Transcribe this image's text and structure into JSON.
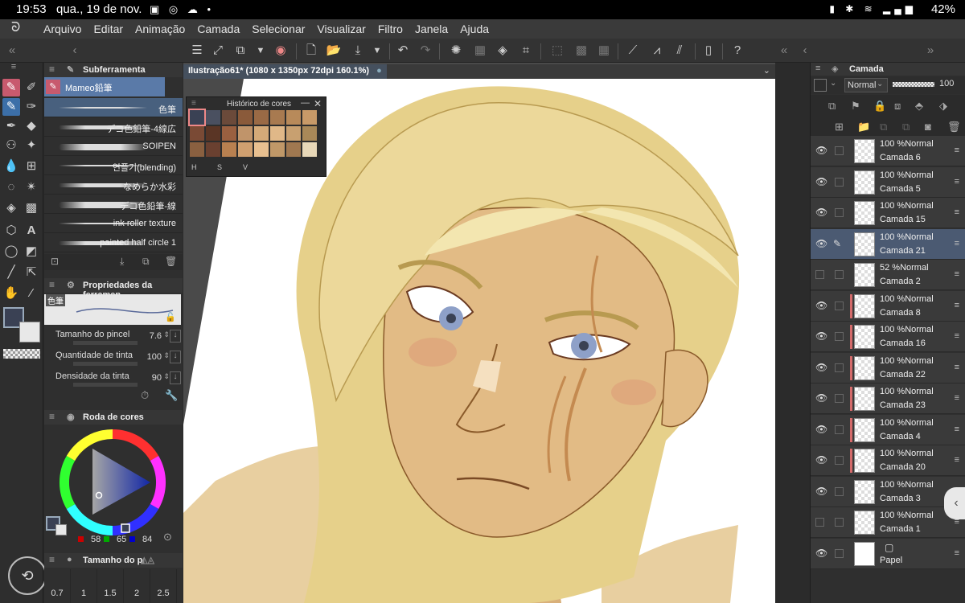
{
  "status": {
    "time": "19:53",
    "date": "qua., 19 de nov.",
    "battery": "42%"
  },
  "menu": [
    "Arquivo",
    "Editar",
    "Animação",
    "Camada",
    "Selecionar",
    "Visualizar",
    "Filtro",
    "Janela",
    "Ajuda"
  ],
  "subtool": {
    "title": "Subferramenta",
    "group": "Mameo鉛筆",
    "brushes": [
      "色筆",
      "デコ色鉛筆-4線広",
      "SOIPEN",
      "연플기(blending)",
      "なめらか水彩",
      "デコ色鉛筆-線",
      "ink roller texture",
      "painted half circle 1"
    ]
  },
  "toolprops": {
    "title": "Propriedades da ferramen",
    "brush_name": "色筆",
    "rows": [
      {
        "label": "Tamanho do pincel",
        "value": "7.6"
      },
      {
        "label": "Quantidade de tinta",
        "value": "100"
      },
      {
        "label": "Densidade da tinta",
        "value": "90"
      }
    ]
  },
  "colorwheel": {
    "title": "Roda de cores",
    "r": "58",
    "g": "65",
    "b": "84",
    "main_color": "#3a4154"
  },
  "brushsize": {
    "title": "Tamanho do p",
    "values": [
      "0.7",
      "1",
      "1.5",
      "2",
      "2.5"
    ]
  },
  "document": {
    "tab": "Ilustração61* (1080 x 1350px 72dpi 160.1%)"
  },
  "colorhistory": {
    "title": "Histórico de cores",
    "modes": [
      "H",
      "S",
      "V"
    ],
    "swatches": [
      "#3a4154",
      "#4a5060",
      "#6b4a3a",
      "#8a5a3a",
      "#9a6a45",
      "#a87a50",
      "#b88a5a",
      "#c89a68",
      "#7a4a35",
      "#5a3525",
      "#9a6040",
      "#c0946a",
      "#d4aa78",
      "#e0b888",
      "#c8a070",
      "#a88858",
      "#8a6040",
      "#6a4030",
      "#b88050",
      "#d0a070",
      "#e8c090",
      "#c09868",
      "#a07850",
      "#e8d8b8"
    ]
  },
  "layerpanel": {
    "title": "Camada",
    "blend": "Normal",
    "opacity": "100",
    "layers": [
      {
        "op": "100 %Normal",
        "name": "Camada 6",
        "eye": true,
        "sel": false,
        "red": false
      },
      {
        "op": "100 %Normal",
        "name": "Camada 5",
        "eye": true,
        "sel": false,
        "red": false
      },
      {
        "op": "100 %Normal",
        "name": "Camada 15",
        "eye": true,
        "sel": false,
        "red": false
      },
      {
        "op": "100 %Normal",
        "name": "Camada 21",
        "eye": true,
        "sel": true,
        "red": false
      },
      {
        "op": "52 %Normal",
        "name": "Camada 2",
        "eye": false,
        "sel": false,
        "red": false
      },
      {
        "op": "100 %Normal",
        "name": "Camada 8",
        "eye": true,
        "sel": false,
        "red": true
      },
      {
        "op": "100 %Normal",
        "name": "Camada 16",
        "eye": true,
        "sel": false,
        "red": true
      },
      {
        "op": "100 %Normal",
        "name": "Camada 22",
        "eye": true,
        "sel": false,
        "red": true
      },
      {
        "op": "100 %Normal",
        "name": "Camada 23",
        "eye": true,
        "sel": false,
        "red": true
      },
      {
        "op": "100 %Normal",
        "name": "Camada 4",
        "eye": true,
        "sel": false,
        "red": true
      },
      {
        "op": "100 %Normal",
        "name": "Camada 20",
        "eye": true,
        "sel": false,
        "red": true
      },
      {
        "op": "100 %Normal",
        "name": "Camada 3",
        "eye": true,
        "sel": false,
        "red": false
      },
      {
        "op": "100 %Normal",
        "name": "Camada 1",
        "eye": false,
        "sel": false,
        "red": false
      },
      {
        "op": "",
        "name": "Papel",
        "eye": true,
        "sel": false,
        "red": false
      }
    ]
  }
}
